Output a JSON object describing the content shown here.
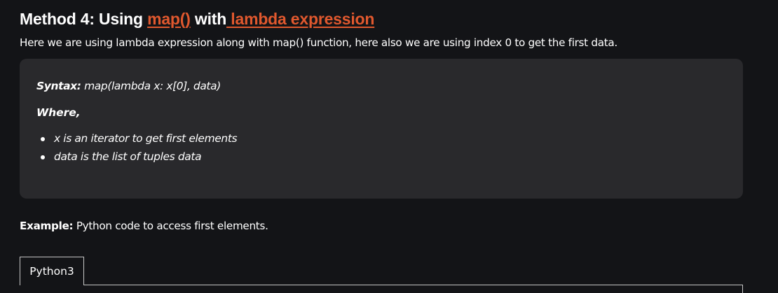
{
  "section": {
    "heading_prefix": "Method 4: Using ",
    "heading_link1": "map()",
    "heading_middle": " with",
    "heading_link2": " lambda expression",
    "intro": "Here we are using lambda expression along with map() function, here also we are using index 0 to get the first data."
  },
  "syntax_box": {
    "syntax_label": "Syntax:",
    "syntax_code": " map(lambda x: x[0], data)",
    "where_label": "Where,",
    "items": [
      "x is an iterator to get first elements",
      "data is the list of tuples data"
    ]
  },
  "example": {
    "label": "Example:",
    "text": " Python code to access first elements."
  },
  "code_block": {
    "tab_label": "Python3"
  },
  "colors": {
    "background": "#131417",
    "box_background": "#29292c",
    "link": "#e0582e",
    "text": "#ffffff"
  }
}
